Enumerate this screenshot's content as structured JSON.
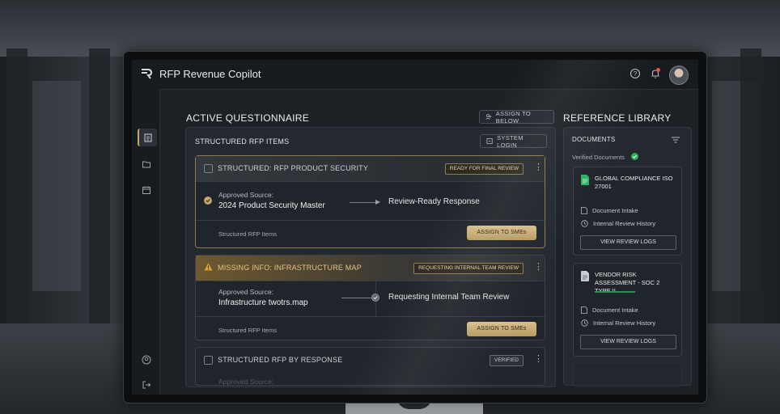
{
  "app": {
    "title": "RFP Revenue Copilot"
  },
  "left": {
    "section_title": "ACTIVE QUESTIONNAIRE",
    "assign_below_label": "ASSIGN TO BELOW",
    "panel_title": "STRUCTURED RFP ITEMS",
    "system_login_label": "SYSTEM LOGIN",
    "cards": [
      {
        "title": "STRUCTURED: RFP PRODUCT SECURITY",
        "badge": "READY FOR FINAL REVIEW",
        "source_label": "Approved Source:",
        "source_value": "2024 Product Security Master",
        "response": "Review-Ready Response",
        "footer": "Structured RFP Items",
        "action": "ASSIGN TO SMEs"
      },
      {
        "title": "MISSING INFO: INFRASTRUCTURE MAP",
        "badge": "REQUESTING INTERNAL TEAM REVIEW",
        "source_label": "Approved Source:",
        "source_value": "Infrastructure twotrs.map",
        "response": "Requesting Internal Team Review",
        "footer": "Structured RFP Items",
        "action": "ASSIGN TO SMEs"
      },
      {
        "title": "STRUCTURED RFP BY RESPONSE",
        "badge": "VERIFIED",
        "source_label": "Approved Source:"
      }
    ]
  },
  "right": {
    "section_title": "REFERENCE LIBRARY",
    "panel_title": "DOCUMENTS",
    "verified_label": "Verified Documents",
    "docs": [
      {
        "title": "GLOBAL COMPLIANCE ISO 27001",
        "row1": "Document Intake",
        "row2": "Internal Review History",
        "button": "VIEW REVIEW LOGS"
      },
      {
        "title": "VENDOR RISK ASSESSMENT - SOC 2 TYPE II",
        "row1": "Document Intake",
        "row2": "Internal Review History",
        "button": "VIEW REVIEW LOGS"
      }
    ]
  },
  "colors": {
    "accent_gold": "#c7a96a",
    "verified_green": "#2fb163",
    "warning_amber": "#e0a23a"
  },
  "icons": [
    "logo-icon",
    "help-icon",
    "bell-icon",
    "clipboard-icon",
    "folder-icon",
    "calendar-icon",
    "user-icon",
    "logout-icon",
    "user-plus-icon",
    "login-icon",
    "filter-icon",
    "document-icon",
    "clock-icon",
    "warning-icon",
    "check-circle-icon"
  ]
}
